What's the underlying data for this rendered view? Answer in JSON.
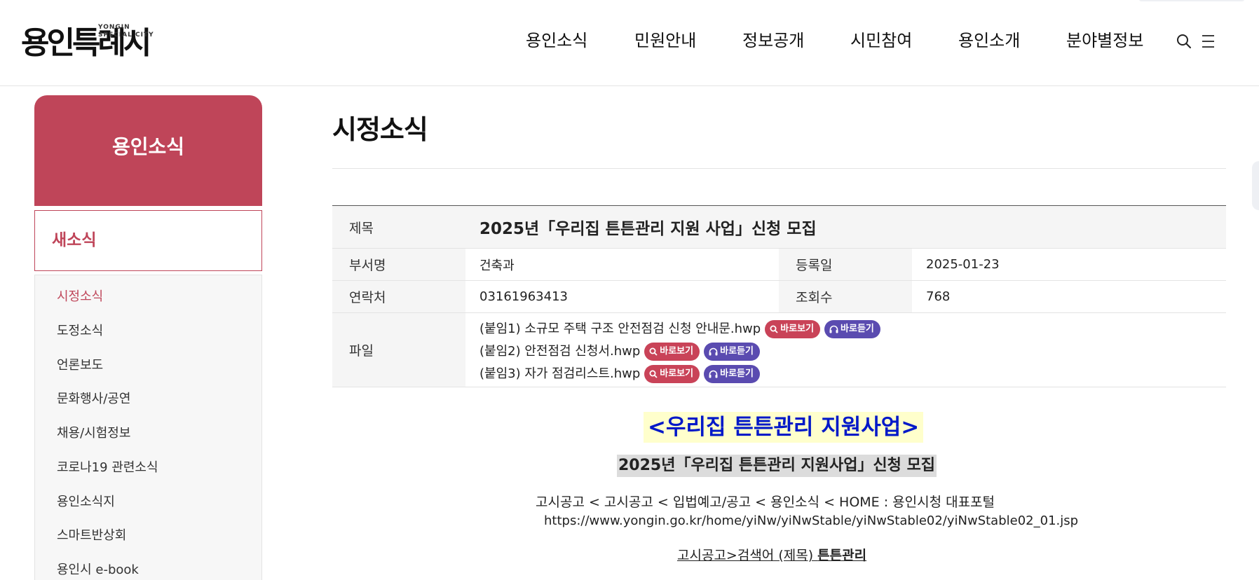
{
  "header": {
    "logo_text": "용인특례시",
    "logo_sub_1": "YONGIN",
    "logo_sub_2": "SPECIAL CITY",
    "nav": [
      "용인소식",
      "민원안내",
      "정보공개",
      "시민참여",
      "용인소개",
      "분야별정보"
    ],
    "icons": {
      "search": "search-icon",
      "menu": "menu-icon"
    }
  },
  "sidebar": {
    "title": "용인소식",
    "section": "새소식",
    "items": [
      "시정소식",
      "도정소식",
      "언론보도",
      "문화행사/공연",
      "채용/시험정보",
      "코로나19 관련소식",
      "용인소식지",
      "스마트반상회",
      "용인시 e-book"
    ],
    "active_index": 0
  },
  "page": {
    "title": "시정소식"
  },
  "article": {
    "labels": {
      "title": "제목",
      "dept": "부서명",
      "date": "등록일",
      "contact": "연락처",
      "views": "조회수",
      "files": "파일"
    },
    "title": "2025년「우리집 튼튼관리 지원 사업」신청 모집",
    "dept": "건축과",
    "date": "2025-01-23",
    "contact": "03161963413",
    "views": "768",
    "files": [
      "(붙임1) 소규모 주택 구조 안전점검 신청 안내문.hwp",
      "(붙임2) 안전점검 신청서.hwp",
      "(붙임3) 자가 점검리스트.hwp"
    ],
    "view_label": "바로보기",
    "listen_label": "바로듣기"
  },
  "body": {
    "headline": "<우리집 튼튼관리 지원사업>",
    "subhead": "2025년「우리집 튼튼관리 지원사업」신청 모집",
    "path": "고시공고 < 고시공고 < 입법예고/공고 < 용인소식 < HOME : 용인시청 대표포털",
    "url": "https://www.yongin.go.kr/home/yiNw/yiNwStable/yiNwStable02/yiNwStable02_01.jsp",
    "search_prefix": "고시공고>검색어 (제목) ",
    "search_term": "튼튼관리"
  },
  "colors": {
    "brand": "#bf4559",
    "view_button": "#c94358",
    "listen_button": "#5a4bb0",
    "headline_text": "#0018c8",
    "headline_bg": "#ffffcc"
  }
}
